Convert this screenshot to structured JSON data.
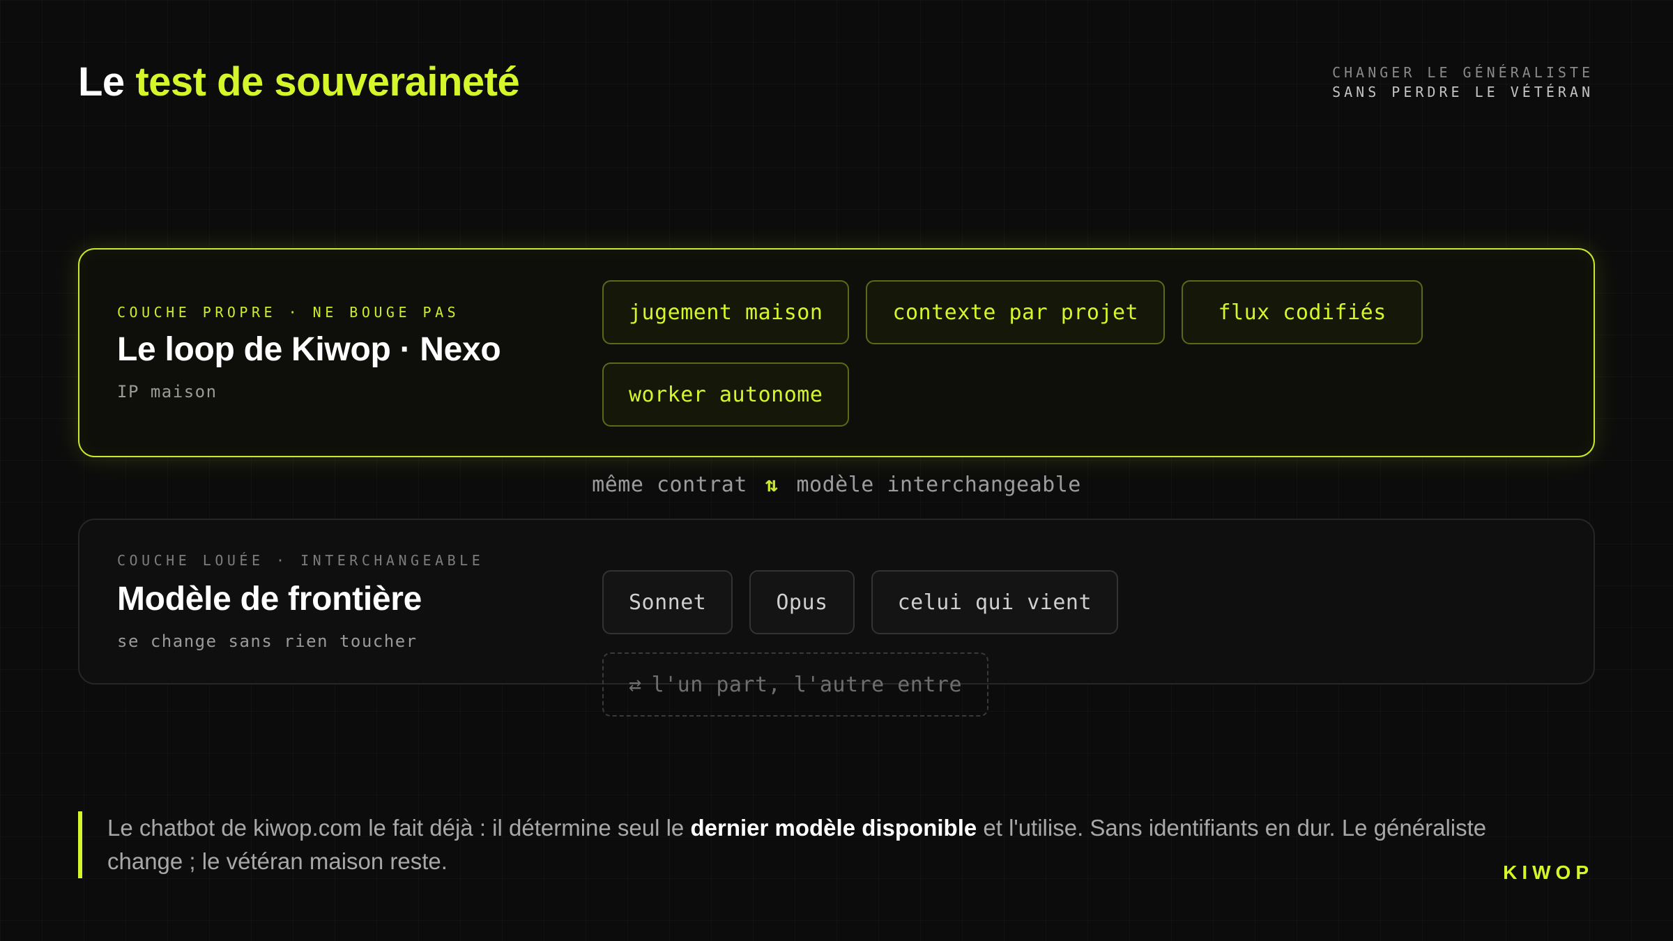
{
  "header": {
    "title_prefix": "Le ",
    "title_accent": "test de souveraineté",
    "tagline_line1": "CHANGER LE GÉNÉRALISTE",
    "tagline_line2": "SANS PERDRE LE VÉTÉRAN"
  },
  "own_layer": {
    "eyebrow": "COUCHE PROPRE · NE BOUGE PAS",
    "heading": "Le loop de Kiwop · Nexo",
    "subtitle": "IP maison",
    "chips": [
      "jugement maison",
      "contexte par projet",
      "flux codifiés",
      "worker autonome"
    ]
  },
  "connector": {
    "left": "même contrat",
    "icon": "swap-vertical-icon",
    "arrows": "⇅",
    "right": "modèle interchangeable"
  },
  "rented_layer": {
    "eyebrow": "COUCHE LOUÉE · INTERCHANGEABLE",
    "heading": "Modèle de frontière",
    "subtitle": "se change sans rien toucher",
    "chips": [
      "Sonnet",
      "Opus",
      "celui qui vient"
    ],
    "swap_chip": {
      "icon": "swap-horizontal-icon",
      "symbol": "⇄",
      "label": "l'un part, l'autre entre"
    }
  },
  "footer": {
    "quote_before": "Le chatbot de kiwop.com le fait déjà : il détermine seul le ",
    "quote_bold": "dernier modèle disponible",
    "quote_after": " et l'utilise. Sans identifiants en dur. Le généraliste change ; le vétéran maison reste.",
    "brand": "KIWOP"
  },
  "colors": {
    "accent": "#d4f62a",
    "background": "#0c0c0c",
    "muted_text": "#9a9a9a"
  }
}
